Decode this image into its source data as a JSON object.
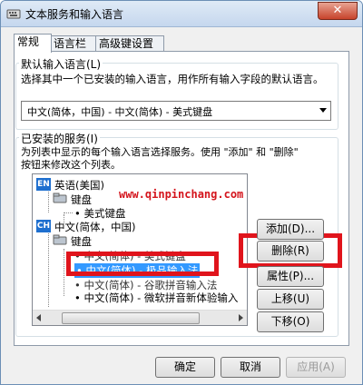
{
  "window": {
    "title": "文本服务和输入语言",
    "close_label": "✕"
  },
  "tabs": [
    {
      "label": "常规"
    },
    {
      "label": "语言栏"
    },
    {
      "label": "高级键设置"
    }
  ],
  "default_lang": {
    "group_label": "默认输入语言(L)",
    "description": "选择其中一个已安装的输入语言，用作所有输入字段的默认语言。",
    "selected_value": "中文(简体，中国) - 中文(简体) - 美式键盘"
  },
  "installed": {
    "group_label": "已安装的服务(I)",
    "description_line1": "为列表中显示的每个输入语言选择服务。使用 \"添加\" 和 \"删除\"",
    "description_line2": "按钮来修改这个列表。",
    "tree": {
      "en_badge": "EN",
      "en_lang": "英语(美国)",
      "en_keyboard": "键盘",
      "en_keyboard_item": "美式键盘",
      "ch_badge": "CH",
      "ch_lang": "中文(简体，中国)",
      "ch_keyboard": "键盘",
      "items": [
        "中文(简体) - 美式键盘",
        "中文(简体) - 极品输入法",
        "中文(简体) - 谷歌拼音输入法",
        "中文(简体) - 微软拼音新体验输入"
      ]
    },
    "buttons": {
      "add": "添加(D)...",
      "remove": "删除(R)",
      "properties": "属性(P)...",
      "move_up": "上移(U)",
      "move_down": "下移(O)"
    }
  },
  "watermark": "www.qinpinchang.com",
  "footer": {
    "ok": "确定",
    "cancel": "取消",
    "apply": "应用(A)"
  },
  "colors": {
    "highlight_box": "#e0141c",
    "selection": "#3399ff",
    "lang_badge": "#1e6fcf"
  }
}
